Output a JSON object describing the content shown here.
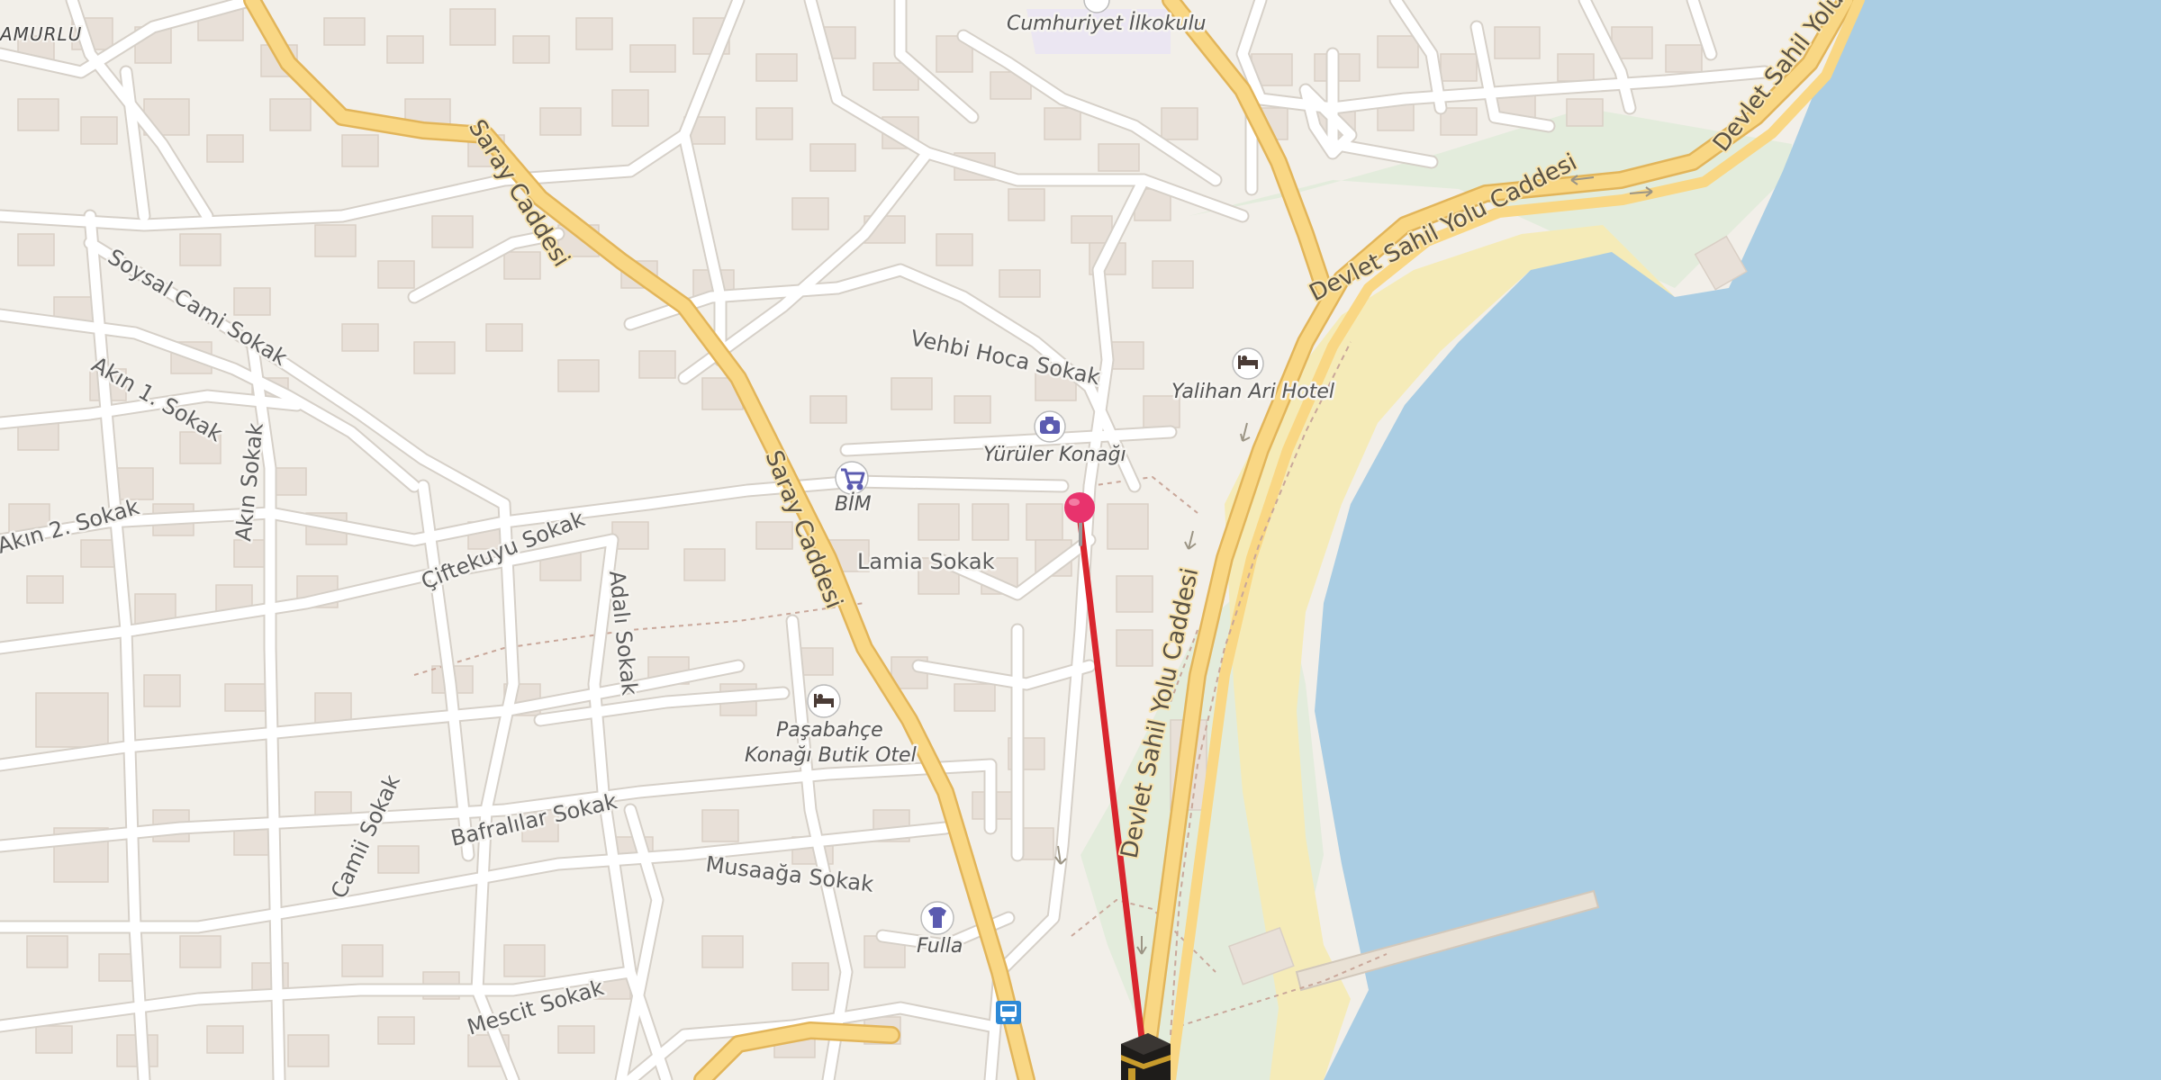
{
  "map": {
    "district": "AMURLU",
    "colors": {
      "land": "#f2efe9",
      "water": "#aacde3",
      "beach": "#f5ebb8",
      "park": "#e3ecdc",
      "building": "#e8e0d8",
      "minor_road": "#ffffff",
      "main_road": "#f9d784",
      "main_road_casing": "#e2b55a",
      "route_line": "#d9262e",
      "marker": "#e8336d",
      "poi_icon": "#5b5bb0"
    },
    "streets": {
      "saray_caddesi": "Saray Caddesi",
      "devlet_sahil_yolu": "Devlet Sahil Yolu Caddesi",
      "devlet_sahil_yolu_short": "Devlet Sahil Yolu C",
      "soysal_cami": "Soysal Cami Sokak",
      "akin_1": "Akın 1. Sokak",
      "akin_2": "Akın 2. Sokak",
      "akin": "Akın Sokak",
      "ciftekuyu": "Çiftekuyu Sokak",
      "adali": "Adalı Sokak",
      "lamia": "Lamia Sokak",
      "vehbi_hoca": "Vehbi Hoca Sokak",
      "bafralilar": "Bafralılar Sokak",
      "musaaga": "Musaağa Sokak",
      "camii": "Camii Sokak",
      "mescit": "Mescit Sokak"
    },
    "pois": [
      {
        "name": "Cumhuriyet İlkokulu",
        "icon": "school-icon"
      },
      {
        "name": "Yalihan Ari Hotel",
        "icon": "hotel-icon"
      },
      {
        "name": "Yürüler Konağı",
        "icon": "camera-icon"
      },
      {
        "name": "BİM",
        "icon": "shopping-cart-icon"
      },
      {
        "name": "Paşabahçe",
        "icon": "hotel-icon"
      },
      {
        "name": "Konağı Butik Otel",
        "icon": "hotel-icon"
      },
      {
        "name": "Fulla",
        "icon": "clothing-icon"
      }
    ],
    "bus_stop_icon": "bus-stop-icon",
    "location_marker_icon": "map-pin-icon",
    "qibla_icon": "kaaba-icon"
  }
}
